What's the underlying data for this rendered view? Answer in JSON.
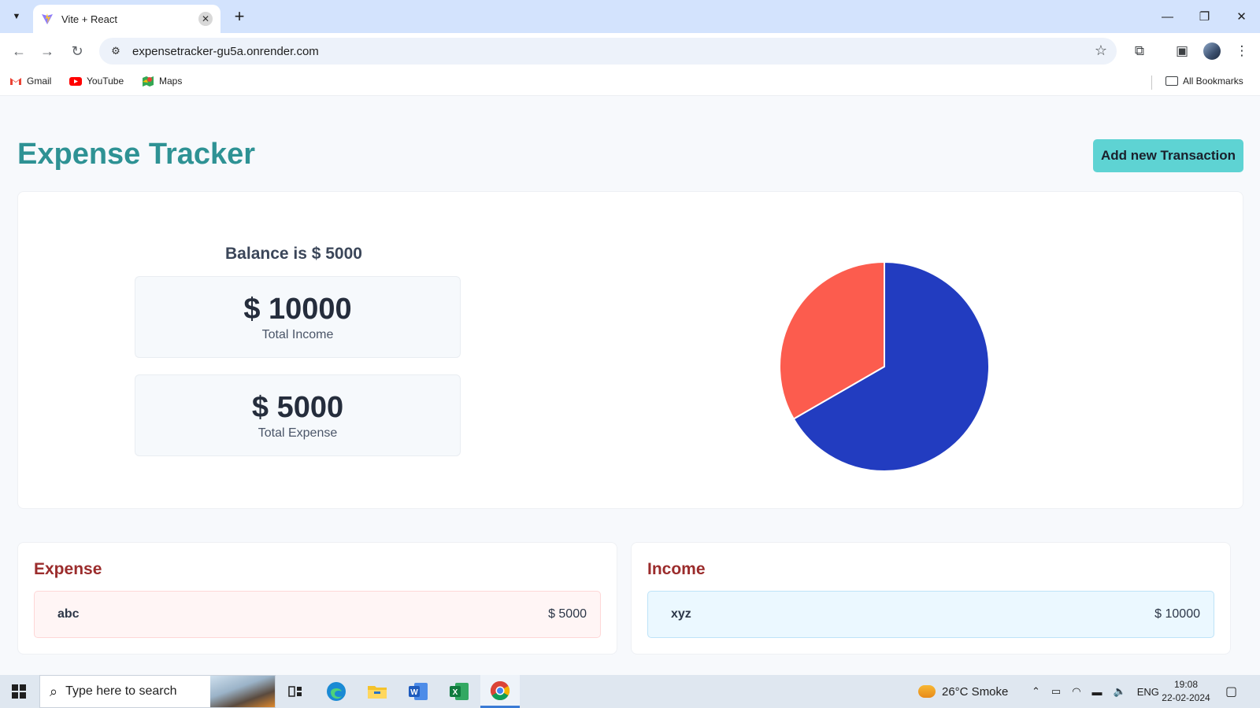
{
  "browser": {
    "tab_title": "Vite + React",
    "url": "expensetracker-gu5a.onrender.com",
    "bookmarks": [
      {
        "label": "Gmail",
        "icon": "gmail-icon"
      },
      {
        "label": "YouTube",
        "icon": "youtube-icon"
      },
      {
        "label": "Maps",
        "icon": "maps-icon"
      }
    ],
    "all_bookmarks": "All Bookmarks"
  },
  "page": {
    "title": "Expense Tracker",
    "add_button": "Add new Transaction",
    "balance_text": "Balance is $ 5000",
    "income": {
      "amount": "$ 10000",
      "label": "Total Income"
    },
    "expense": {
      "amount": "$ 5000",
      "label": "Total Expense"
    },
    "expense_section": {
      "title": "Expense",
      "items": [
        {
          "name": "abc",
          "amount": "$ 5000"
        }
      ]
    },
    "income_section": {
      "title": "Income",
      "items": [
        {
          "name": "xyz",
          "amount": "$ 10000"
        }
      ]
    }
  },
  "chart_data": {
    "type": "pie",
    "categories": [
      "Total Income",
      "Total Expense"
    ],
    "values": [
      10000,
      5000
    ],
    "colors": [
      "#223cc0",
      "#fc5c4e"
    ],
    "title": ""
  },
  "taskbar": {
    "search_placeholder": "Type here to search",
    "weather": "26°C  Smoke",
    "language": "ENG",
    "time": "19:08",
    "date": "22-02-2024"
  },
  "colors": {
    "accent_title": "#2e9294",
    "add_button_bg": "#5ed3d3",
    "section_title": "#9b2c2c"
  }
}
